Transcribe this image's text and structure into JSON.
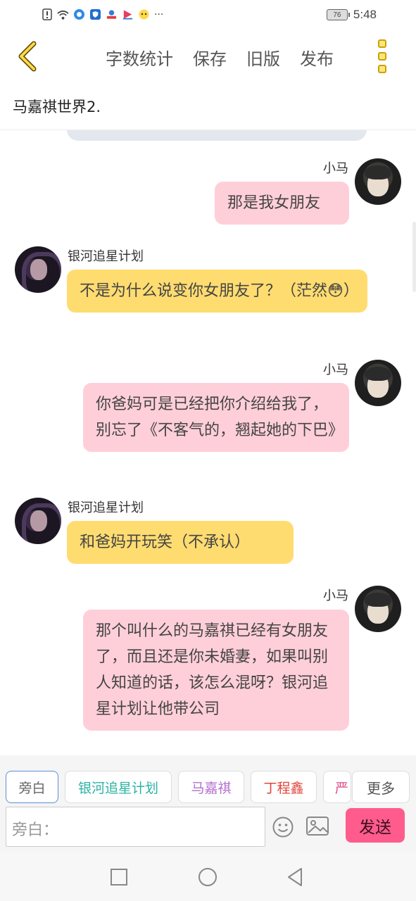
{
  "status_bar": {
    "icons": [
      "alert-icon",
      "wifi-icon",
      "app-icon-1",
      "shield-app-icon",
      "app-icon-3",
      "app-icon-4",
      "bee-app-icon"
    ],
    "more": "···",
    "battery": "76",
    "time": "5:48"
  },
  "toolbar": {
    "actions": [
      "字数统计",
      "保存",
      "旧版",
      "发布"
    ]
  },
  "doc_title": "马嘉祺世界2.",
  "messages": [
    {
      "sender": "小马",
      "text": "那是我女朋友",
      "side": "right",
      "color": "#ffcfd9"
    },
    {
      "sender": "银河追星计划",
      "text": "不是为什么说变你女朋友了？（茫然😳）",
      "side": "left",
      "color": "#ffdc70"
    },
    {
      "sender": "小马",
      "text": "你爸妈可是已经把你介绍给我了，别忘了《不客气的，翘起她的下巴》",
      "side": "right",
      "color": "#ffcfd9"
    },
    {
      "sender": "银河追星计划",
      "text": "和爸妈开玩笑（不承认）",
      "side": "left",
      "color": "#ffdc70"
    },
    {
      "sender": "小马",
      "text": "那个叫什么的马嘉祺已经有女朋友了，而且还是你未婚妻，如果叫别人知道的话，该怎么混呀？银河追星计划让他带公司",
      "side": "right",
      "color": "#ffcfd9"
    }
  ],
  "composer": {
    "roles": [
      {
        "label": "旁白",
        "color": "#666666"
      },
      {
        "label": "银河追星计划",
        "color": "#2bb3a6"
      },
      {
        "label": "马嘉祺",
        "color": "#b36fd0"
      },
      {
        "label": "丁程鑫",
        "color": "#e0453a"
      },
      {
        "label": "严",
        "color": "#e04a8a"
      }
    ],
    "more_label": "更多",
    "input_placeholder": "旁白：",
    "send_label": "发送"
  },
  "colors": {
    "accent": "#ff5c8d",
    "bubble_self": "#ffcfd9",
    "bubble_other": "#ffdc70"
  }
}
